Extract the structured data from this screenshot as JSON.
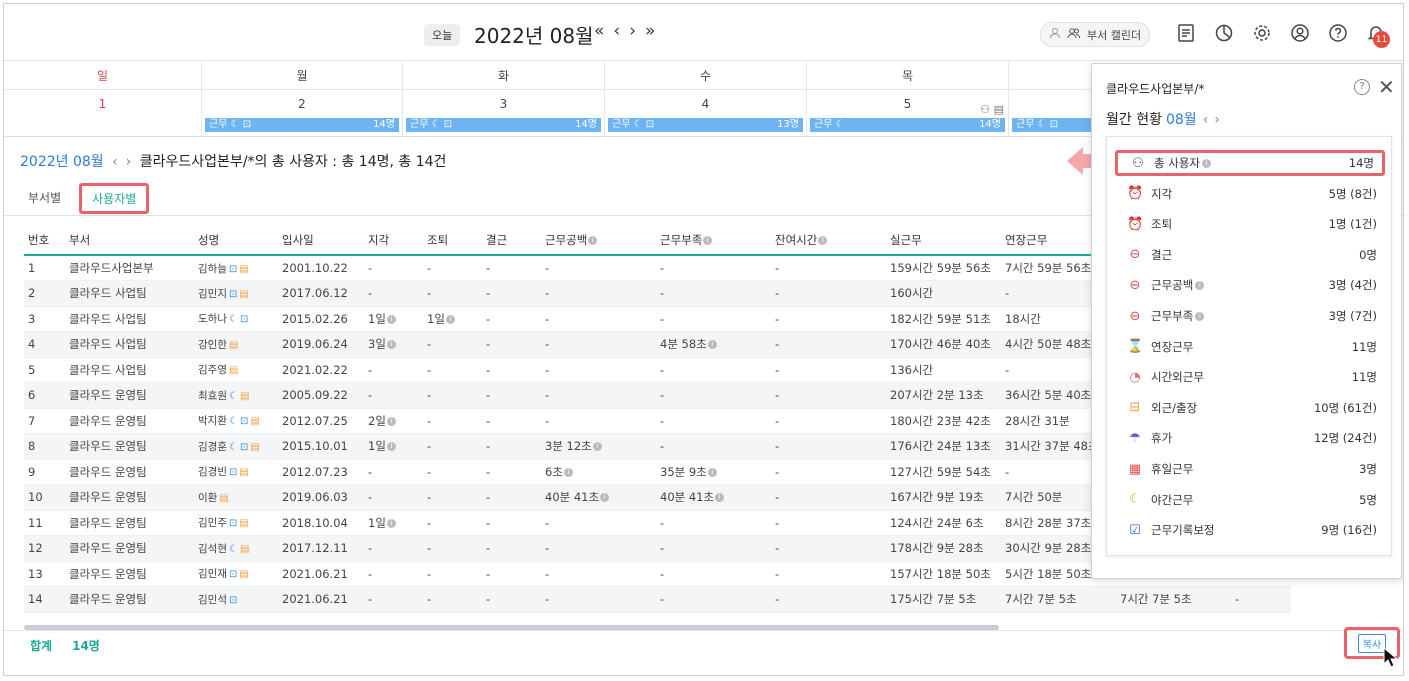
{
  "topbar": {
    "today": "오늘",
    "month": "2022년 08월",
    "nav": [
      "«",
      "‹",
      "›",
      "»"
    ],
    "dept_calendar": "부서 캘린더",
    "bell_count": "11"
  },
  "calendar": {
    "days": [
      {
        "name": "일",
        "date": "1",
        "bar_label": "",
        "bar_count": ""
      },
      {
        "name": "월",
        "date": "2",
        "bar_label": "근무 ☾ ⊡",
        "bar_count": "14명"
      },
      {
        "name": "화",
        "date": "3",
        "bar_label": "근무 ☾ ⊡",
        "bar_count": "14명"
      },
      {
        "name": "수",
        "date": "4",
        "bar_label": "근무 ☾ ⊡",
        "bar_count": "13명"
      },
      {
        "name": "목",
        "date": "5",
        "bar_label": "근무 ☾",
        "bar_count": "14명"
      },
      {
        "name": "",
        "date": "",
        "bar_label": "근무 ☾ ⊡",
        "bar_count": ""
      }
    ]
  },
  "summary": {
    "month": "2022년 08월",
    "text": "클라우드사업본부/*의 총 사용자 : 총 14명, 총 14건"
  },
  "tabs": [
    "부서별",
    "사용자별"
  ],
  "table": {
    "headers": [
      "번호",
      "부서",
      "성명",
      "입사일",
      "지각",
      "조퇴",
      "결근",
      "근무공백",
      "근무부족",
      "잔여시간",
      "실근무",
      "연장근무",
      "",
      ""
    ],
    "rows": [
      [
        "1",
        "클라우드사업본부",
        "김하늘",
        "2001.10.22",
        "-",
        "-",
        "-",
        "-",
        "-",
        "-",
        "159시간 59분 56초",
        "7시간 59분 56초",
        "",
        ""
      ],
      [
        "2",
        "클라우드 사업팀",
        "김민지",
        "2017.06.12",
        "-",
        "-",
        "-",
        "-",
        "-",
        "-",
        "160시간",
        "-",
        "",
        ""
      ],
      [
        "3",
        "클라우드 사업팀",
        "도하나",
        "2015.02.26",
        "1일",
        "1일",
        "-",
        "-",
        "-",
        "-",
        "182시간 59분 51초",
        "18시간",
        "",
        ""
      ],
      [
        "4",
        "클라우드 사업팀",
        "강인한",
        "2019.06.24",
        "3일",
        "-",
        "-",
        "-",
        "4분 58초",
        "-",
        "170시간 46분 40초",
        "4시간 50분 48초",
        "",
        ""
      ],
      [
        "5",
        "클라우드 사업팀",
        "김주영",
        "2021.02.22",
        "-",
        "-",
        "-",
        "-",
        "-",
        "-",
        "136시간",
        "-",
        "",
        ""
      ],
      [
        "6",
        "클라우드 운영팀",
        "최효원",
        "2005.09.22",
        "-",
        "-",
        "-",
        "-",
        "-",
        "-",
        "207시간 2분 13초",
        "36시간 5분 40초",
        "",
        ""
      ],
      [
        "7",
        "클라우드 운영팀",
        "박지환",
        "2012.07.25",
        "2일",
        "-",
        "-",
        "-",
        "-",
        "-",
        "180시간 23분 42초",
        "28시간 31분",
        "",
        ""
      ],
      [
        "8",
        "클라우드 운영팀",
        "김경훈",
        "2015.10.01",
        "1일",
        "-",
        "-",
        "3분 12초",
        "-",
        "-",
        "176시간 24분 13초",
        "31시간 37분 48초",
        "",
        ""
      ],
      [
        "9",
        "클라우드 운영팀",
        "김경빈",
        "2012.07.23",
        "-",
        "-",
        "-",
        "6초",
        "35분 9초",
        "-",
        "127시간 59분 54초",
        "-",
        "",
        ""
      ],
      [
        "10",
        "클라우드 운영팀",
        "이환",
        "2019.06.03",
        "-",
        "-",
        "-",
        "40분 41초",
        "40분 41초",
        "-",
        "167시간 9분 19초",
        "7시간 50분",
        "",
        ""
      ],
      [
        "11",
        "클라우드 운영팀",
        "김민주",
        "2018.10.04",
        "1일",
        "-",
        "-",
        "-",
        "-",
        "-",
        "124시간 24분 6초",
        "8시간 28분 37초",
        "",
        ""
      ],
      [
        "12",
        "클라우드 운영팀",
        "김석현",
        "2017.12.11",
        "-",
        "-",
        "-",
        "-",
        "-",
        "-",
        "178시간 9분 28초",
        "30시간 9분 28초",
        "",
        ""
      ],
      [
        "13",
        "클라우드 운영팀",
        "김민재",
        "2021.06.21",
        "-",
        "-",
        "-",
        "-",
        "-",
        "-",
        "157시간 18분 50초",
        "5시간 18분 50초",
        "",
        ""
      ],
      [
        "14",
        "클라우드 운영팀",
        "김민석",
        "2021.06.21",
        "-",
        "-",
        "-",
        "-",
        "-",
        "-",
        "175시간 7분 5초",
        "7시간 7분 5초",
        "7시간 7분 5초",
        "-"
      ]
    ]
  },
  "footer": {
    "total_label": "합계",
    "total_value": "14명",
    "copy": "복사"
  },
  "popup": {
    "title": "클라우드사업본부/*",
    "subtitle": "월간 현황",
    "month": "08월",
    "items": [
      {
        "icon": "users-icon",
        "glyph": "⚇",
        "label": "총 사용자",
        "value": "14명",
        "color": "#555"
      },
      {
        "icon": "alarm-icon",
        "glyph": "⏰",
        "label": "지각",
        "value": "5명 (8건)",
        "color": "#e0782a"
      },
      {
        "icon": "alarm-icon",
        "glyph": "⏰",
        "label": "조퇴",
        "value": "1명 (1건)",
        "color": "#e0a02a"
      },
      {
        "icon": "minus-circle-icon",
        "glyph": "⊖",
        "label": "결근",
        "value": "0명",
        "color": "#e05050"
      },
      {
        "icon": "minus-circle-icon",
        "glyph": "⊖",
        "label": "근무공백",
        "value": "3명 (4건)",
        "color": "#e05050"
      },
      {
        "icon": "minus-circle-icon",
        "glyph": "⊖",
        "label": "근무부족",
        "value": "3명 (7건)",
        "color": "#e05050"
      },
      {
        "icon": "hourglass-icon",
        "glyph": "⌛",
        "label": "연장근무",
        "value": "11명",
        "color": "#3a6bd0"
      },
      {
        "icon": "clock-icon",
        "glyph": "◔",
        "label": "시간외근무",
        "value": "11명",
        "color": "#e06a6a"
      },
      {
        "icon": "briefcase-icon",
        "glyph": "⊟",
        "label": "외근/출장",
        "value": "10명 (61건)",
        "color": "#f0a040"
      },
      {
        "icon": "umbrella-icon",
        "glyph": "☂",
        "label": "휴가",
        "value": "12명 (24건)",
        "color": "#7a55c8"
      },
      {
        "icon": "calendar-icon",
        "glyph": "▦",
        "label": "휴일근무",
        "value": "3명",
        "color": "#e05050"
      },
      {
        "icon": "moon-icon",
        "glyph": "☾",
        "label": "야간근무",
        "value": "5명",
        "color": "#e8b020"
      },
      {
        "icon": "clipboard-icon",
        "glyph": "☑",
        "label": "근무기록보정",
        "value": "9명 (16건)",
        "color": "#3a6bd0"
      }
    ]
  }
}
